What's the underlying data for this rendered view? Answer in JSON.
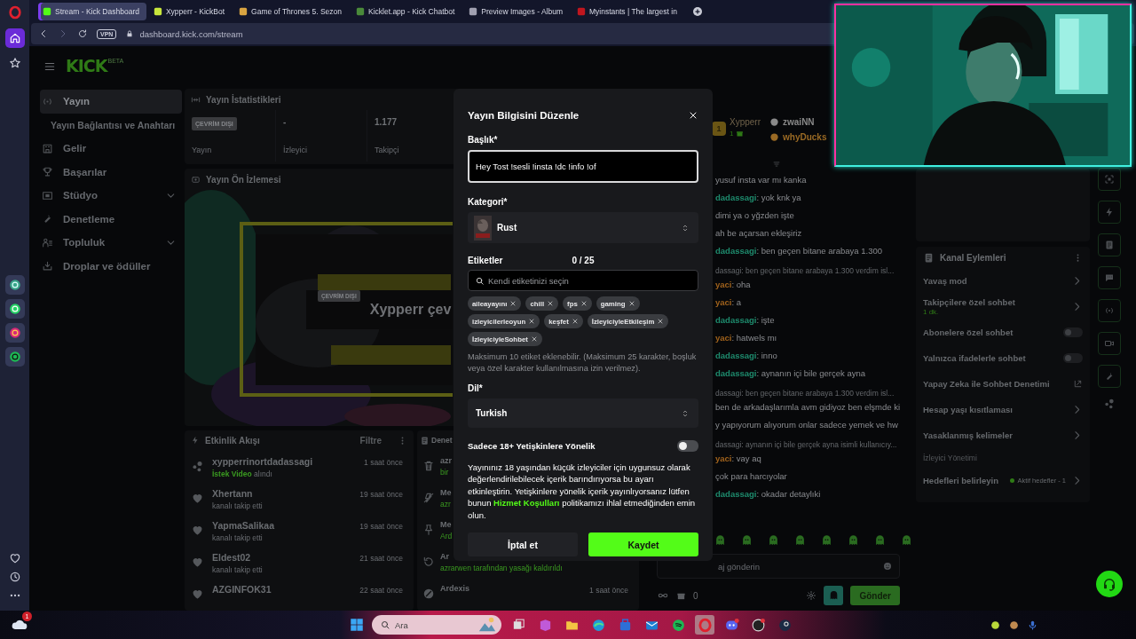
{
  "browser": {
    "tabs": [
      {
        "title": "Stream - Kick Dashboard",
        "selected": true
      },
      {
        "title": "Xypperr - KickBot",
        "selected": false
      },
      {
        "title": "Game of Thrones 5. Sezon",
        "selected": false
      },
      {
        "title": "Kicklet.app - Kick Chatbot",
        "selected": false
      },
      {
        "title": "Preview Images - Album",
        "selected": false
      },
      {
        "title": "Myinstants | The largest in",
        "selected": false
      }
    ],
    "vpn": "VPN",
    "url": "dashboard.kick.com/stream"
  },
  "header": {
    "logo": "KICK",
    "logo_tag": "BETA"
  },
  "nav": {
    "items": [
      {
        "label": "Yayın",
        "selected": true,
        "children": [
          {
            "label": "Yayın Bağlantısı ve Anahtarı",
            "selected": false
          }
        ]
      },
      {
        "label": "Gelir",
        "selected": false
      },
      {
        "label": "Başarılar",
        "selected": false
      },
      {
        "label": "Stüdyo",
        "selected": false,
        "expanded": false
      },
      {
        "label": "Denetleme",
        "selected": false
      },
      {
        "label": "Topluluk",
        "selected": false,
        "expanded": false
      },
      {
        "label": "Droplar ve ödüller",
        "selected": false
      }
    ]
  },
  "stats": {
    "title": "Yayın İstatistikleri",
    "items": [
      {
        "badge": "ÇEVRİM DIŞI",
        "label": "Yayın"
      },
      {
        "value": "-",
        "label": "İzleyici"
      },
      {
        "value": "1.177",
        "label": "Takipçi"
      }
    ]
  },
  "preview": {
    "title": "Yayın Ön İzlemesi",
    "badge": "ÇEVRİM DIŞI",
    "channel": "Xypperr çev"
  },
  "activity": {
    "title": "Etkinlik Akışı",
    "filter": "Filtre",
    "events": [
      {
        "kind": "request",
        "user": "xypperrinortdadassagi",
        "highlight": "İstek Video",
        "detail": " alındı",
        "time": "1 saat önce"
      },
      {
        "kind": "follow",
        "user": "Xhertann",
        "detail": "kanalı takip etti",
        "time": "19 saat önce"
      },
      {
        "kind": "follow",
        "user": "YapmaSalikaa",
        "detail": "kanalı takip etti",
        "time": "19 saat önce"
      },
      {
        "kind": "follow",
        "user": "Eldest02",
        "detail": "kanalı takip etti",
        "time": "21 saat önce"
      },
      {
        "kind": "follow",
        "user": "AZGINFOK31",
        "time": "22 saat önce"
      }
    ]
  },
  "moderation": {
    "title": "Denet",
    "items": [
      {
        "kind": "delete",
        "name": "azr",
        "detail": "bir"
      },
      {
        "kind": "unmute",
        "name": "Me",
        "detail": "azr"
      },
      {
        "kind": "pin",
        "name": "Me",
        "detail": "Ard"
      },
      {
        "kind": "undo",
        "name": "Ar",
        "detail": "azrarwen tarafından yasağı kaldırıldı"
      },
      {
        "kind": "ban",
        "name": "Ardexis",
        "time": "1 saat önce"
      }
    ]
  },
  "chat": {
    "leader": {
      "rank": "1",
      "name": "Xypperr",
      "gifts": "1"
    },
    "runners": [
      {
        "name": "zwaiNN",
        "color": "#8a8a8a"
      },
      {
        "name": "whyDucks",
        "color": "#9a6a24"
      }
    ],
    "messages": [
      {
        "kind": "message",
        "text": "yusuf insta var mı kanka"
      },
      {
        "kind": "message",
        "user": "dadassagi",
        "color": "#1e8c6e",
        "text": ": yok knk ya"
      },
      {
        "kind": "message",
        "text": "dimi ya o yğzden işte"
      },
      {
        "kind": "message",
        "text": "ah be açarsan ekleşiriz"
      },
      {
        "kind": "message",
        "user": "dadassagi",
        "color": "#1e8c6e",
        "text": ": ben geçen bitane arabaya 1.300"
      },
      {
        "kind": "reply",
        "text": "dassagi: ben geçen bitane arabaya 1.300 verdim isl..."
      },
      {
        "kind": "message",
        "user": "yaci",
        "color": "#a0621c",
        "text": ": oha"
      },
      {
        "kind": "message",
        "user": "yaci",
        "color": "#a0621c",
        "text": ": a"
      },
      {
        "kind": "message",
        "user": "dadassagi",
        "color": "#1e8c6e",
        "text": ": işte"
      },
      {
        "kind": "message",
        "user": "yaci",
        "color": "#a0621c",
        "text": ": hatwels mı"
      },
      {
        "kind": "message",
        "user": "dadassagi",
        "color": "#1e8c6e",
        "text": ": inno"
      },
      {
        "kind": "message",
        "user": "dadassagi",
        "color": "#1e8c6e",
        "text": ": aynanın içi bile gerçek ayna"
      },
      {
        "kind": "reply",
        "text": "dassagi: ben geçen bitane arabaya 1.300 verdim isl..."
      },
      {
        "kind": "message",
        "text": "ben de arkadaşlarımla avm gidiyoz ben elşmde ki"
      },
      {
        "kind": "message",
        "text": "y yapıyorum alıyorum onlar sadece yemek ve hw"
      },
      {
        "kind": "reply",
        "text": "dassagi: aynanın içi bile gerçek ayna isimli kullanıcıy..."
      },
      {
        "kind": "message",
        "user": "yaci",
        "color": "#a0621c",
        "text": ": vay aq"
      },
      {
        "kind": "message",
        "text": "çok para harcıyolar"
      },
      {
        "kind": "message",
        "user": "dadassagi",
        "color": "#1e8c6e",
        "text": ": okadar detaylıki"
      }
    ],
    "placeholder": "aj gönderin",
    "count": "0",
    "send": "Gönder"
  },
  "channel_actions": {
    "title": "Kanal Eylemleri",
    "items": [
      {
        "kind": "link",
        "label": "Yavaş mod"
      },
      {
        "kind": "link",
        "label": "Takipçilere özel sohbet",
        "sub": "1 dk."
      },
      {
        "kind": "toggle",
        "label": "Abonelere özel sohbet",
        "on": false
      },
      {
        "kind": "toggle",
        "label": "Yalnızca ifadelerle sohbet",
        "on": false
      },
      {
        "kind": "external",
        "label": "Yapay Zeka ile Sohbet Denetimi"
      },
      {
        "kind": "link",
        "label": "Hesap yaşı kısıtlaması"
      },
      {
        "kind": "link",
        "label": "Yasaklanmış kelimeler"
      },
      {
        "kind": "section",
        "label": "İzleyici Yönetimi"
      },
      {
        "kind": "link",
        "label": "Hedefleri belirleyin",
        "status": "Aktif hedefler - 1"
      }
    ]
  },
  "modal": {
    "title": "Yayın Bilgisini Düzenle",
    "title_label": "Başlık*",
    "title_value": "Hey Tost !sesli !insta !dc !info !of",
    "category_label": "Kategori*",
    "category": "Rust",
    "tags_label": "Etiketler",
    "tags_count": "0 / 25",
    "tag_placeholder": "Kendi etiketinizi seçin",
    "tags": [
      "aileayayını",
      "chill",
      "fps",
      "gaming",
      "izleyicilerleoyun",
      "keşfet",
      "İzleyiciyleEtkileşim",
      "İzleyiciyleSohbet"
    ],
    "tags_hint": "Maksimum 10 etiket eklenebilir. (Maksimum 25 karakter, boşluk veya özel karakter kullanılmasına izin verilmez).",
    "language_label": "Dil*",
    "language": "Turkish",
    "mature": {
      "label": "Sadece 18+ Yetişkinlere Yönelik",
      "on": false
    },
    "info_before": "Yayınınız 18 yaşından küçük izleyiciler için uygunsuz olarak değerlendirilebilecek içerik barındırıyorsa bu ayarı etkinleştirin. Yetişkinlere yönelik içerik yayınlıyorsanız lütfen bunun ",
    "info_link": "Hizmet Koşulları",
    "info_after": " politikamızı ihlal etmediğinden emin olun.",
    "cancel": "İptal et",
    "save": "Kaydet"
  },
  "taskbar": {
    "search_placeholder": "Ara",
    "weather_badge": "1"
  }
}
